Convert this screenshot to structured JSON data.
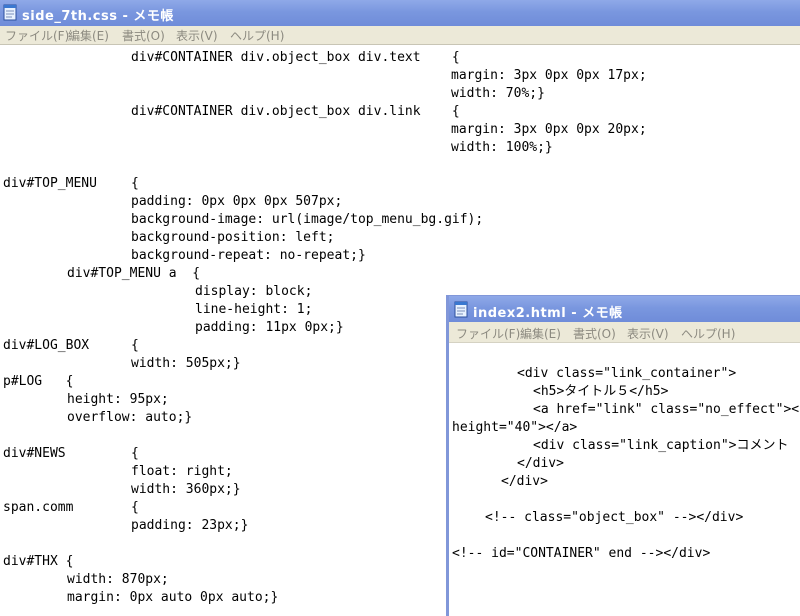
{
  "window1": {
    "title": "side_7th.css - メモ帳",
    "menu": [
      "ファイル(F)",
      "編集(E)",
      "書式(O)",
      "表示(V)",
      "ヘルプ(H)"
    ],
    "lines": [
      "div#CONTAINER div.object_box div.text    {",
      "margin: 3px 0px 0px 17px;",
      "width: 70%;}",
      "div#CONTAINER div.object_box div.link    {",
      "margin: 3px 0px 0px 20px;",
      "width: 100%;}",
      "div#TOP_MENU",
      "{",
      "padding: 0px 0px 0px 507px;",
      "background-image: url(image/top_menu_bg.gif);",
      "background-position: left;",
      "background-repeat: no-repeat;}",
      "div#TOP_MENU a  {",
      "display: block;",
      "line-height: 1;",
      "padding: 11px 0px;}",
      "div#LOG_BOX",
      "{",
      "width: 505px;}",
      "p#LOG   {",
      "height: 95px;",
      "overflow: auto;}",
      "div#NEWS",
      "{",
      "float: right;",
      "width: 360px;}",
      "span.comm",
      "{",
      "padding: 23px;}",
      "div#THX {",
      "width: 870px;",
      "margin: 0px auto 0px auto;}"
    ]
  },
  "window2": {
    "title": "index2.html - メモ帳",
    "menu": [
      "ファイル(F)",
      "編集(E)",
      "書式(O)",
      "表示(V)",
      "ヘルプ(H)"
    ],
    "lines": [
      "<div class=\"link_container\">",
      "<h5>タイトル５</h5>",
      "<a href=\"link\" class=\"no_effect\"><",
      "height=\"40\"></a>",
      "<div class=\"link_caption\">コメント",
      "</div>",
      "</div>",
      "<!-- class=\"object_box\" --></div>",
      "<!-- id=\"CONTAINER\" end --></div>"
    ]
  },
  "colors": {
    "titlebar": "#7a97df",
    "menubar": "#ece9d8",
    "menu_text": "#8c8a80"
  }
}
